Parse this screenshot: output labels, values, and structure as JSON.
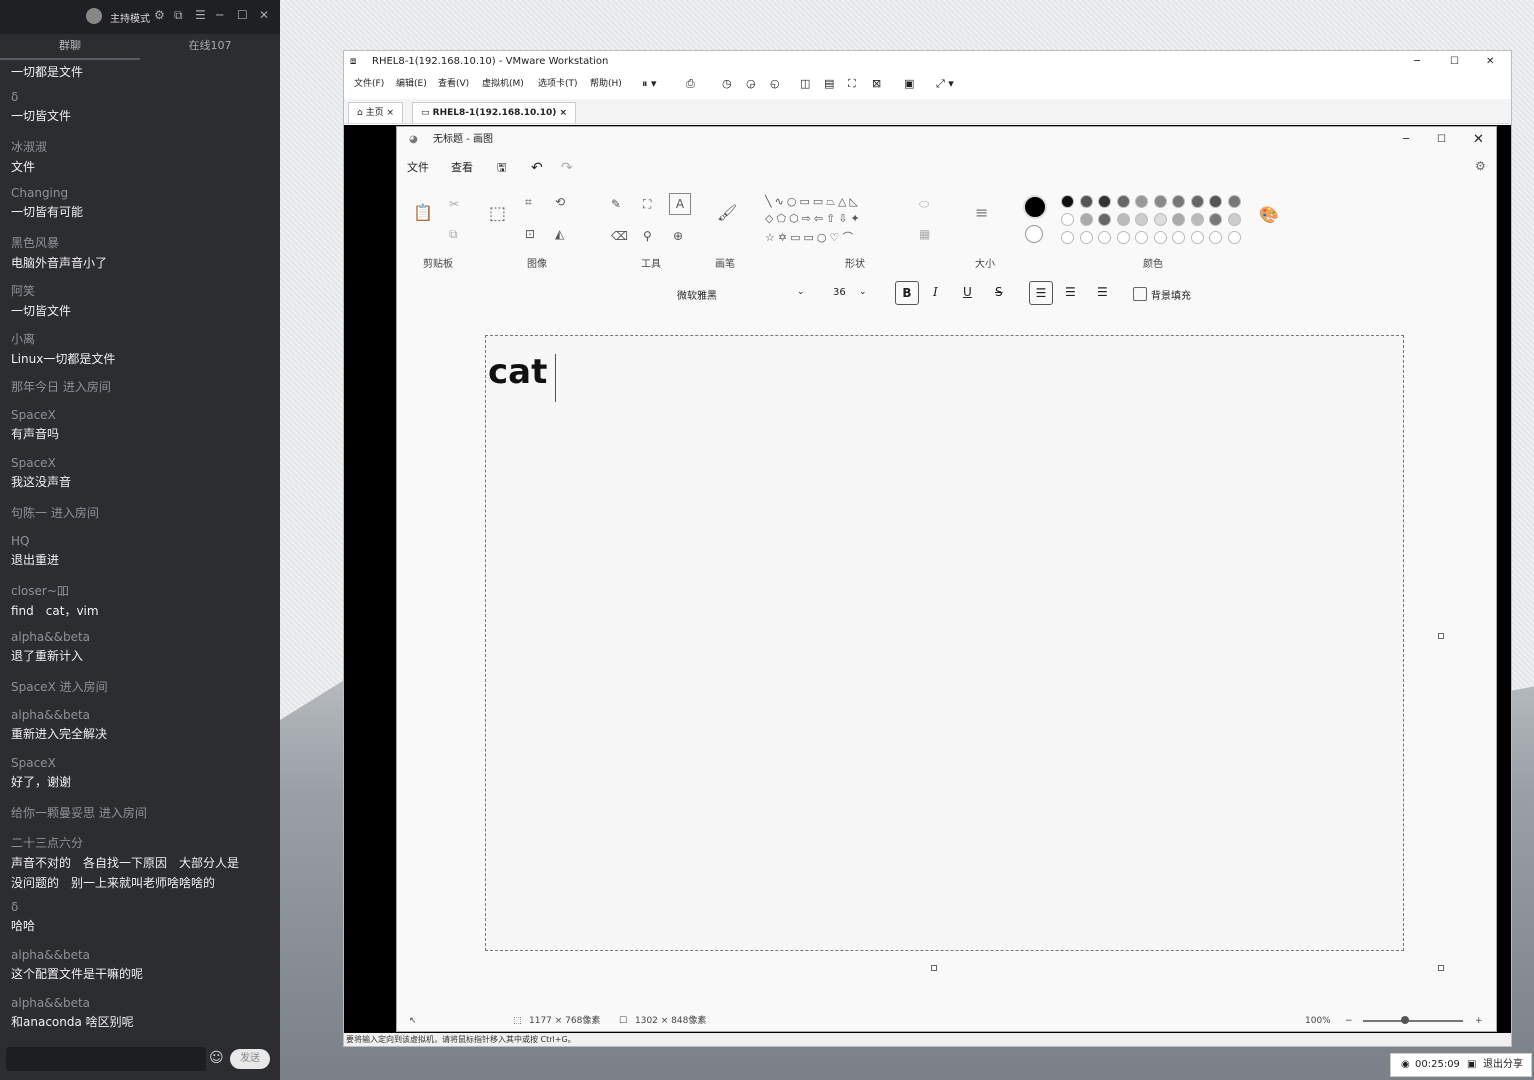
{
  "chat": {
    "header_title": "主持模式",
    "tab_group": "群聊",
    "tab_online": "在线107",
    "messages": [
      {
        "name": "",
        "text": "一切都是文件"
      },
      {
        "name": "δ",
        "text": "一切皆文件"
      },
      {
        "name": "冰淑淑",
        "text": "文件"
      },
      {
        "name": "Changing",
        "text": "一切皆有可能"
      },
      {
        "name": "黑色风暴",
        "text": "电脑外音声音小了"
      },
      {
        "name": "阿笑",
        "text": "一切皆文件"
      },
      {
        "name": "小离",
        "text": "Linux一切都是文件"
      },
      {
        "system": "那年今日 进入房间"
      },
      {
        "name": "SpaceX",
        "text": "有声音吗"
      },
      {
        "name": "SpaceX",
        "text": "我这没声音"
      },
      {
        "system": "句陈一 进入房间"
      },
      {
        "name": "HQ",
        "text": "退出重进"
      },
      {
        "name": "closer~吅",
        "text": "find　cat，vim"
      },
      {
        "name": "alpha&&beta",
        "text": "退了重新计入"
      },
      {
        "system": "SpaceX 进入房间"
      },
      {
        "name": "alpha&&beta",
        "text": "重新进入完全解决"
      },
      {
        "name": "SpaceX",
        "text": "好了，谢谢"
      },
      {
        "system": "给你一颗曼妥思 进入房间"
      },
      {
        "name": "二十三点六分",
        "text": "声音不对的　各自找一下原因　大部分人是",
        "text2": "没问题的　别一上来就叫老师啥啥啥的"
      },
      {
        "name": "δ",
        "text": "哈哈"
      },
      {
        "name": "alpha&&beta",
        "text": "这个配置文件是干嘛的呢"
      },
      {
        "name": "alpha&&beta",
        "text": "和anaconda 啥区别呢"
      }
    ],
    "send_label": "发送"
  },
  "vmware": {
    "title": "RHEL8-1(192.168.10.10) - VMware Workstation",
    "menu": [
      "文件(F)",
      "编辑(E)",
      "查看(V)",
      "虚拟机(M)",
      "选项卡(T)",
      "帮助(H)"
    ],
    "tab_home": "主页",
    "tab_vm": "RHEL8-1(192.168.10.10)",
    "status": "要将输入定向到该虚拟机，请将鼠标指针移入其中或按 Ctrl+G。"
  },
  "paint": {
    "title": "无标题 - 画图",
    "menu": [
      "文件",
      "查看"
    ],
    "groups": [
      "剪贴板",
      "图像",
      "工具",
      "画笔",
      "形状",
      "大小",
      "颜色"
    ],
    "font_name": "微软雅黑",
    "font_size": "36",
    "bold": "B",
    "italic": "I",
    "underline": "U",
    "strike": "S",
    "bg_fill_label": "背景填充",
    "canvas_text": "cat",
    "selection_size": "1177 × 768像素",
    "canvas_size": "1302 × 848像素",
    "zoom": "100%"
  },
  "timer": {
    "time": "00:25:09",
    "exit_label": "退出分享"
  }
}
